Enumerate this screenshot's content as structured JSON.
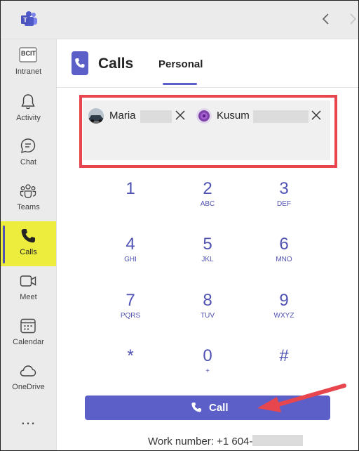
{
  "topbar": {
    "back_icon": "chevron-left-icon",
    "forward_icon": "chevron-right-icon"
  },
  "rail": {
    "items": [
      {
        "label": "Intranet",
        "icon": "bcit-logo-icon",
        "logo_text": "BCIT"
      },
      {
        "label": "Activity",
        "icon": "bell-icon"
      },
      {
        "label": "Chat",
        "icon": "chat-icon"
      },
      {
        "label": "Teams",
        "icon": "teams-icon"
      },
      {
        "label": "Calls",
        "icon": "phone-icon",
        "active": true
      },
      {
        "label": "Meet",
        "icon": "video-icon"
      },
      {
        "label": "Calendar",
        "icon": "calendar-icon"
      },
      {
        "label": "OneDrive",
        "icon": "cloud-icon"
      }
    ],
    "more": "..."
  },
  "header": {
    "title": "Calls",
    "tab": "Personal"
  },
  "recipients": [
    {
      "name": "Maria",
      "avatar": "car-photo"
    },
    {
      "name": "Kusum",
      "avatar": "flower-photo"
    }
  ],
  "dialpad": [
    {
      "digit": "1",
      "letters": ""
    },
    {
      "digit": "2",
      "letters": "ABC"
    },
    {
      "digit": "3",
      "letters": "DEF"
    },
    {
      "digit": "4",
      "letters": "GHI"
    },
    {
      "digit": "5",
      "letters": "JKL"
    },
    {
      "digit": "6",
      "letters": "MNO"
    },
    {
      "digit": "7",
      "letters": "PQRS"
    },
    {
      "digit": "8",
      "letters": "TUV"
    },
    {
      "digit": "9",
      "letters": "WXYZ"
    },
    {
      "digit": "*",
      "letters": ""
    },
    {
      "digit": "0",
      "letters": "+"
    },
    {
      "digit": "#",
      "letters": ""
    }
  ],
  "call_button": {
    "label": "Call"
  },
  "work_number": {
    "label": "Work number: +1 604-"
  },
  "colors": {
    "accent": "#5b5fc7",
    "highlight_border": "#e8464e",
    "active_rail": "#eded3d"
  }
}
